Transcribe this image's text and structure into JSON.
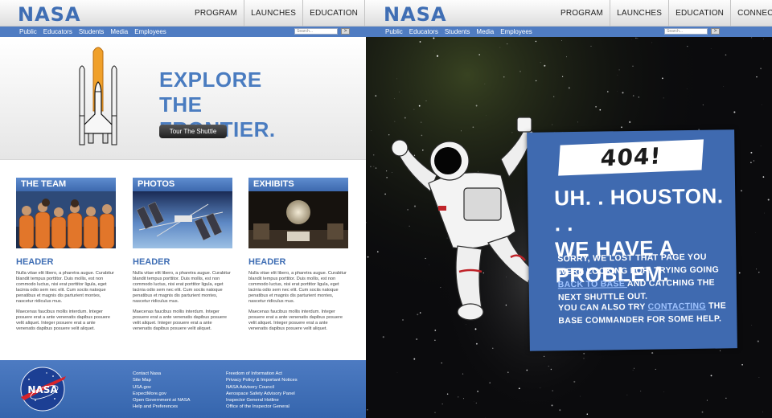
{
  "brand": {
    "logo_text": "NASA",
    "color_blue": "#4a7cc0",
    "color_dark": "#1f1f1f"
  },
  "nav": {
    "main": [
      "PROGRAM",
      "LAUNCHES",
      "EDUCATION",
      "CONNECT"
    ],
    "sub": [
      "Public",
      "Educators",
      "Students",
      "Media",
      "Employees"
    ],
    "search_placeholder": "Search...",
    "search_go": ">"
  },
  "hero": {
    "title": "EXPLORE\nTHE FRONTIER.",
    "button_label": "Tour The Shuttle",
    "image_icon": "space-shuttle-icon"
  },
  "cards": [
    {
      "label": "THE TEAM",
      "header": "HEADER",
      "p1": "Nulla vitae elit libero, a pharetra augue. Curabitur blandit tempus porttitor. Duis mollis, est non commodo luctus, nisi erat porttitor ligula, eget lacinia odio sem nec elit. Cum sociis natoque penatibus et magnis dis parturient montes, nascetur ridiculus mus.",
      "p2": "Maecenas faucibus mollis interdum. Integer posuere erat a ante venenatis dapibus posuere velit aliquet. Integer posuere erat a ante venenatis dapibus posuere velit aliquet."
    },
    {
      "label": "PHOTOS",
      "header": "HEADER",
      "p1": "Nulla vitae elit libero, a pharetra augue. Curabitur blandit tempus porttitor. Duis mollis, est non commodo luctus, nisi erat porttitor ligula, eget lacinia odio sem nec elit. Cum sociis natoque penatibus et magnis dis parturient montes, nascetur ridiculus mus.",
      "p2": "Maecenas faucibus mollis interdum. Integer posuere erat a ante venenatis dapibus posuere velit aliquet. Integer posuere erat a ante venenatis dapibus posuere velit aliquet."
    },
    {
      "label": "EXHIBITS",
      "header": "HEADER",
      "p1": "Nulla vitae elit libero, a pharetra augue. Curabitur blandit tempus porttitor. Duis mollis, est non commodo luctus, nisi erat porttitor ligula, eget lacinia odio sem nec elit. Cum sociis natoque penatibus et magnis dis parturient montes, nascetur ridiculus mus.",
      "p2": "Maecenas faucibus mollis interdum. Integer posuere erat a ante venenatis dapibus posuere velit aliquet. Integer posuere erat a ante venenatis dapibus posuere velit aliquet."
    }
  ],
  "footer": {
    "col1": [
      "Contact Nasa",
      "Site Map",
      "USA.gov",
      "ExpectMore.gov",
      "Open Government at NASA",
      "Help and Preferences"
    ],
    "col2": [
      "Freedom of Information Act",
      "Privacy Policy & Important Notices",
      "NASA Advisory Council",
      "Aerospace Safety Advisory Panel",
      "Inspector General Hotline",
      "Office of the Inspector General"
    ],
    "meatball_text": "NASA"
  },
  "error": {
    "code": "404!",
    "headline_1": "UH. . HOUSTON. . .",
    "headline_2": "WE HAVE A PROBLEM.",
    "msg1_a": "SORRY, WE LOST THAT PAGE YOU WERE LOOKING FOR. TRYING GOING ",
    "msg1_link": "BACK TO BASE ",
    "msg1_b": "AND CATCHING THE NEXT SHUTTLE OUT.",
    "msg2_a": "YOU CAN ALSO TRY ",
    "msg2_link": "CONTACTING",
    "msg2_b": " THE BASE COMMANDER FOR SOME HELP.",
    "image_icon": "astronaut-icon"
  }
}
